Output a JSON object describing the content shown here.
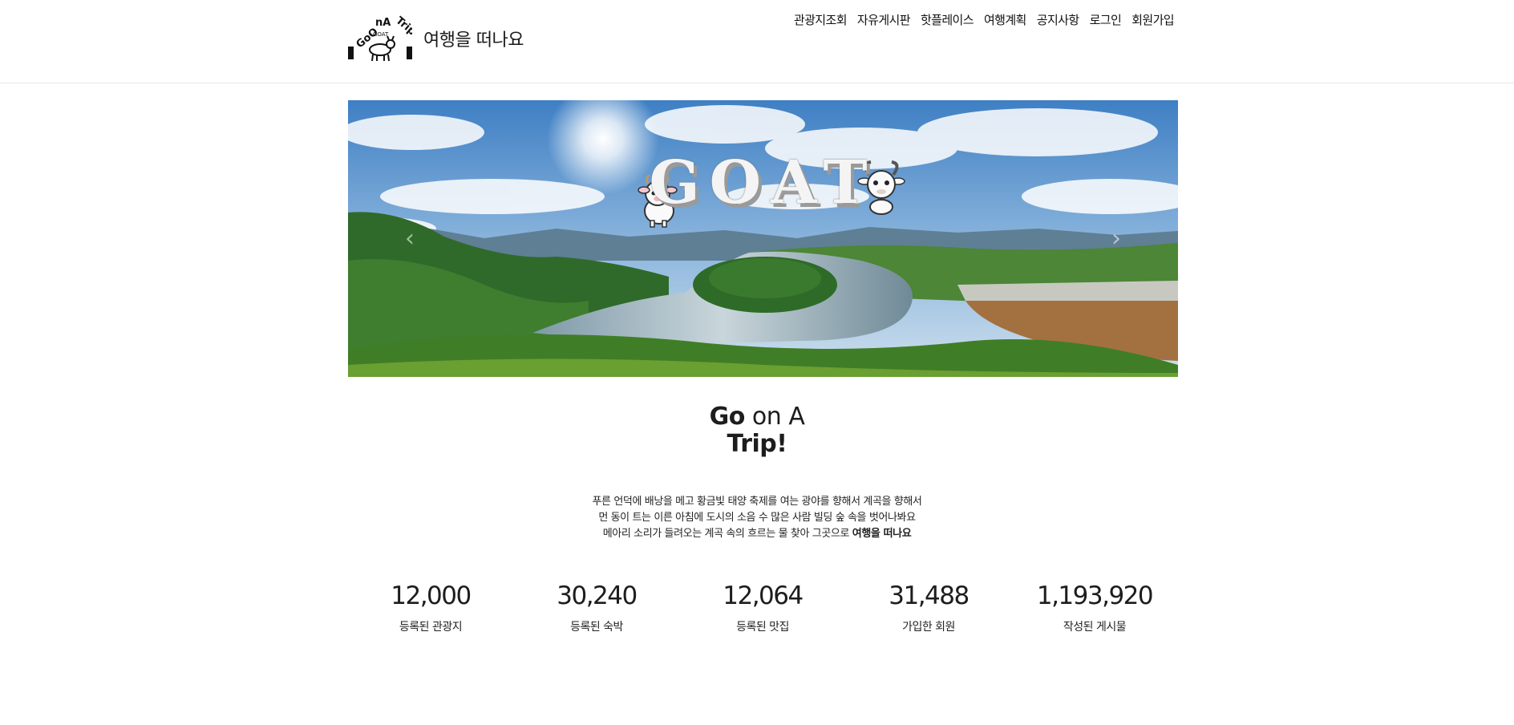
{
  "header": {
    "site_title": "여행을 떠나요",
    "logo_text": "GoOnATrip"
  },
  "nav": {
    "items": [
      {
        "label": "관광지조회"
      },
      {
        "label": "자유게시판"
      },
      {
        "label": "핫플레이스"
      },
      {
        "label": "여행계획"
      },
      {
        "label": "공지사항"
      },
      {
        "label": "로그인"
      },
      {
        "label": "회원가입"
      }
    ]
  },
  "hero": {
    "wordmark": "GOAT",
    "prev_icon": "chevron-left-icon",
    "next_icon": "chevron-right-icon"
  },
  "intro": {
    "title_line1_a": "Go",
    "title_line1_b": " on A",
    "title_line2": "Trip!",
    "desc_line1": "푸른 언덕에 배낭을 메고 황금빛 태양 축제를 여는 광야를 향해서 계곡을 향해서",
    "desc_line2": "먼 동이 트는 이른 아침에 도시의 소음 수 많은 사람 빌딩 숲 속을 벗어나봐요",
    "desc_line3": "메아리 소리가 들려오는 계곡 속의 흐르는 물 찾아 그곳으로 ",
    "desc_line3_bold": "여행을 떠나요"
  },
  "stats": [
    {
      "value": "12,000",
      "label": "등록된 관광지"
    },
    {
      "value": "30,240",
      "label": "등록된 숙박"
    },
    {
      "value": "12,064",
      "label": "등록된 맛집"
    },
    {
      "value": "31,488",
      "label": "가입한 회원"
    },
    {
      "value": "1,193,920",
      "label": "작성된 게시물"
    }
  ]
}
